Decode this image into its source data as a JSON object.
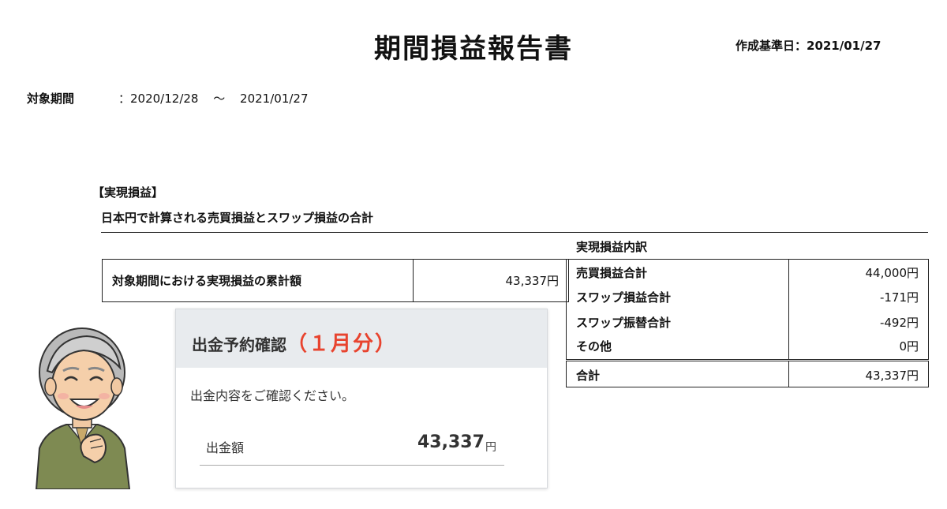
{
  "report": {
    "title": "期間損益報告書",
    "created_label": "作成基準日：2021/01/27",
    "period_label": "対象期間",
    "period_start": "：2020/12/28",
    "period_sep": "〜",
    "period_end": "2021/01/27"
  },
  "realized": {
    "section_title": "【実現損益】",
    "description": "日本円で計算される売買損益とスワップ損益の合計",
    "cumulative_label": "対象期間における実現損益の累計額",
    "cumulative_value": "43,337円"
  },
  "breakdown": {
    "title": "実現損益内訳",
    "rows": [
      {
        "label": "売買損益合計",
        "value": "44,000円"
      },
      {
        "label": "スワップ損益合計",
        "value": "-171円"
      },
      {
        "label": "スワップ振替合計",
        "value": "-492円"
      },
      {
        "label": "その他",
        "value": "0円"
      }
    ],
    "total_label": "合計",
    "total_value": "43,337円"
  },
  "withdrawal_card": {
    "title": "出金予約確認",
    "month_note": "（１月分）",
    "message": "出金内容をご確認ください。",
    "amount_label": "出金額",
    "amount": "43,337",
    "unit": "円",
    "accent_color": "#e8432e"
  },
  "illustration": {
    "icon": "smiling-elderly-man-icon"
  }
}
